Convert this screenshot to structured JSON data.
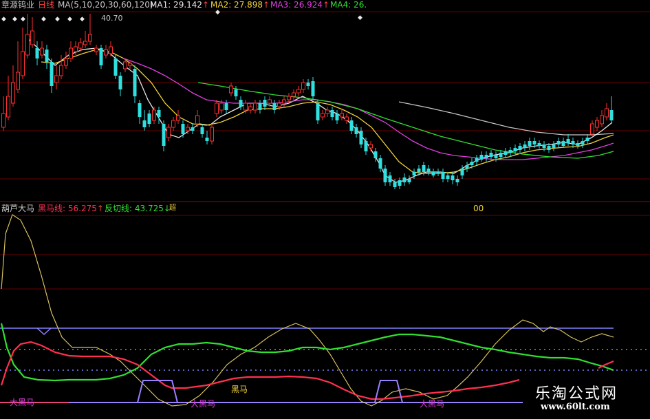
{
  "header": {
    "stock_name": "章源钨业",
    "period": "日线",
    "ma_def": "MA(5,10,20,30,60,120)",
    "ma1": "MA1: 29.142",
    "ma2": "MA2: 27.898",
    "ma3": "MA3: 26.924",
    "ma4": "MA4: 26.",
    "price_peak": "40.70"
  },
  "indicator": {
    "title": "葫芦大马",
    "black_horse_line": "黑马线: 56.275",
    "fanqie_line": "反切线: 43.725",
    "extra": "超",
    "zero_label": "00"
  },
  "signals": {
    "big_black_horse": "大黑马",
    "black_horse": "黑马"
  },
  "watermark": {
    "name": "乐淘公式网",
    "url": "www.60lt.com"
  },
  "colors": {
    "up_candle": "#ff3030",
    "down_candle": "#30e0e0",
    "ma1": "#e8e8e8",
    "ma2": "#f2d23a",
    "ma3": "#e040e0",
    "ma4": "#30e030",
    "black_horse_line": "#ff3050",
    "fanqie_line": "#30e030",
    "grid": "#7a0000"
  }
}
